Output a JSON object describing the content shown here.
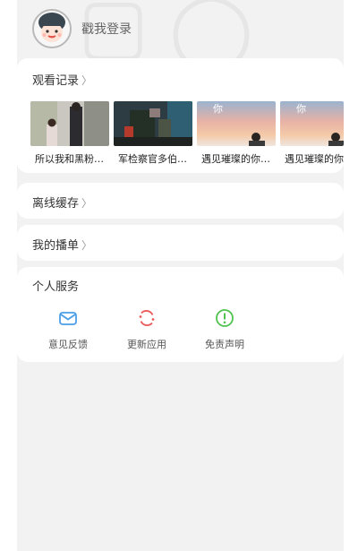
{
  "header": {
    "login_text": "戳我登录",
    "avatar_icon": "cartoon-avatar-icon"
  },
  "history": {
    "title": "观看记录",
    "items": [
      {
        "caption": "所以我和黑粉…",
        "thumb": "thumbnail-couple-street"
      },
      {
        "caption": "军检察官多伯…",
        "thumb": "thumbnail-soldier-interior"
      },
      {
        "caption": "遇见璀璨的你…",
        "thumb": "thumbnail-sunset-sky"
      },
      {
        "caption": "遇见璀璨的你",
        "thumb": "thumbnail-sunset-sky"
      }
    ]
  },
  "offline": {
    "title": "离线缓存"
  },
  "playlist": {
    "title": "我的播单"
  },
  "services": {
    "title": "个人服务",
    "items": [
      {
        "label": "意见反馈",
        "icon": "envelope-icon",
        "color": "#4a9fe8"
      },
      {
        "label": "更新应用",
        "icon": "refresh-icon",
        "color": "#ec5b5b"
      },
      {
        "label": "免责声明",
        "icon": "exclamation-circle-icon",
        "color": "#4fc24f"
      }
    ]
  },
  "colors": {
    "background": "#f2f2f2",
    "card": "#ffffff"
  }
}
